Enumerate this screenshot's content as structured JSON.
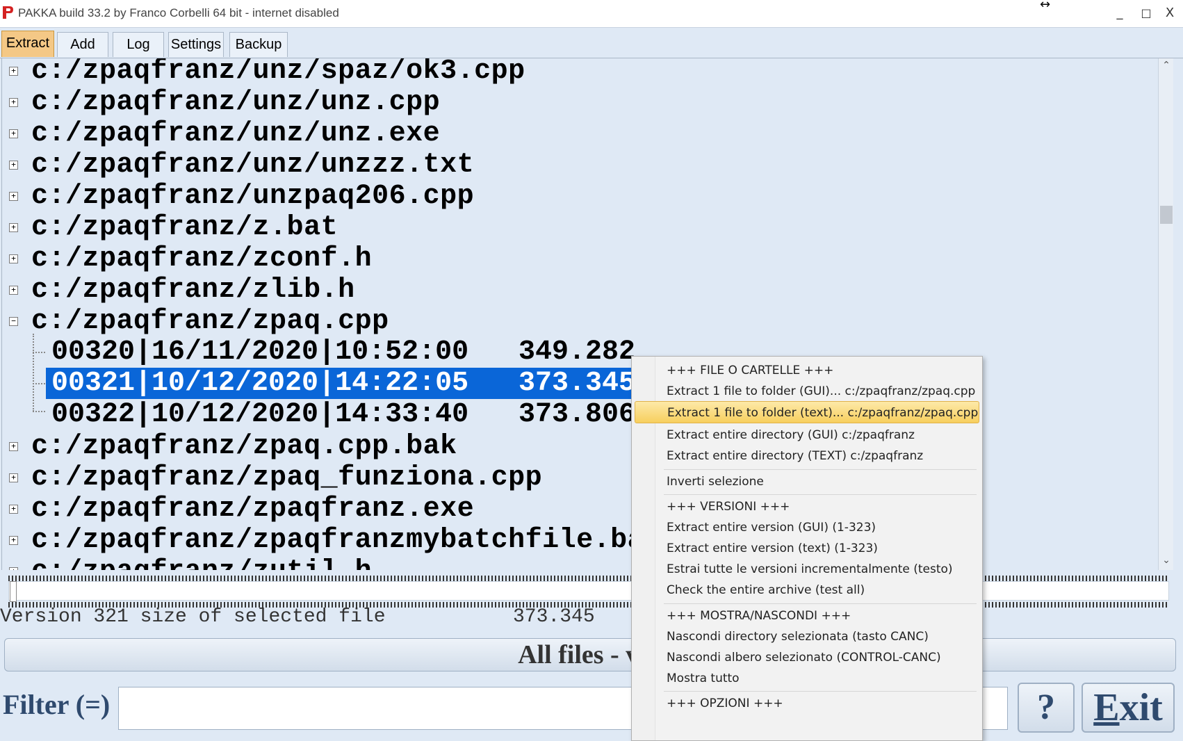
{
  "window": {
    "title": "PAKKA build 33.2 by Franco Corbelli 64 bit - internet disabled",
    "minimize": "_",
    "maximize": "□",
    "close": "X"
  },
  "tabs": [
    {
      "label": "Extract"
    },
    {
      "label": "Add"
    },
    {
      "label": "Log"
    },
    {
      "label": "Settings"
    },
    {
      "label": "Backup"
    }
  ],
  "tree": {
    "files_top": [
      "c:/zpaqfranz/unz/spaz/ok3.cpp",
      "c:/zpaqfranz/unz/unz.cpp",
      "c:/zpaqfranz/unz/unz.exe",
      "c:/zpaqfranz/unz/unzzz.txt",
      "c:/zpaqfranz/unzpaq206.cpp",
      "c:/zpaqfranz/z.bat",
      "c:/zpaqfranz/zconf.h",
      "c:/zpaqfranz/zlib.h",
      "c:/zpaqfranz/zpaq.cpp"
    ],
    "versions": [
      {
        "id": "00320|16/11/2020|10:52:00",
        "size": "349.282"
      },
      {
        "id": "00321|10/12/2020|14:22:05",
        "size": "373.345"
      },
      {
        "id": "00322|10/12/2020|14:33:40",
        "size": "373.806"
      }
    ],
    "files_bottom": [
      "c:/zpaqfranz/zpaq.cpp.bak",
      "c:/zpaqfranz/zpaq_funziona.cpp",
      "c:/zpaqfranz/zpaqfranz.exe",
      "c:/zpaqfranz/zpaqfranzmybatchfile.ba",
      "c:/zpaqfranz/zutil.h"
    ]
  },
  "status": {
    "text": "Version 321 size of selected file",
    "size": "373.345"
  },
  "allfiles_label": "All files - ver",
  "filter": {
    "label": "Filter (=)",
    "value": ""
  },
  "buttons": {
    "help": "?",
    "exit_first": "E",
    "exit_rest": "xit"
  },
  "context_menu": [
    {
      "label": "+++ FILE O CARTELLE +++"
    },
    {
      "label": "Extract 1 file to folder (GUI)... c:/zpaqfranz/zpaq.cpp"
    },
    {
      "label": "Extract 1 file to folder (text)... c:/zpaqfranz/zpaq.cpp"
    },
    {
      "label": "Extract entire directory (GUI) c:/zpaqfranz"
    },
    {
      "label": "Extract entire directory (TEXT) c:/zpaqfranz"
    },
    {
      "label": "Inverti selezione"
    },
    {
      "label": "+++ VERSIONI +++"
    },
    {
      "label": "Extract entire version (GUI) (1-323)"
    },
    {
      "label": "Extract entire version (text) (1-323)"
    },
    {
      "label": "Estrai tutte le versioni incrementalmente (testo)"
    },
    {
      "label": "Check the entire archive (test all)"
    },
    {
      "label": "+++ MOSTRA/NASCONDI +++"
    },
    {
      "label": "Nascondi directory selezionata (tasto CANC)"
    },
    {
      "label": "Nascondi albero selezionato (CONTROL-CANC)"
    },
    {
      "label": "Mostra tutto"
    },
    {
      "label": "+++ OPZIONI +++"
    }
  ],
  "colors": {
    "selection": "#0a66d8",
    "active_tab": "#f4c886",
    "menu_highlight": "#f7cf5e"
  }
}
